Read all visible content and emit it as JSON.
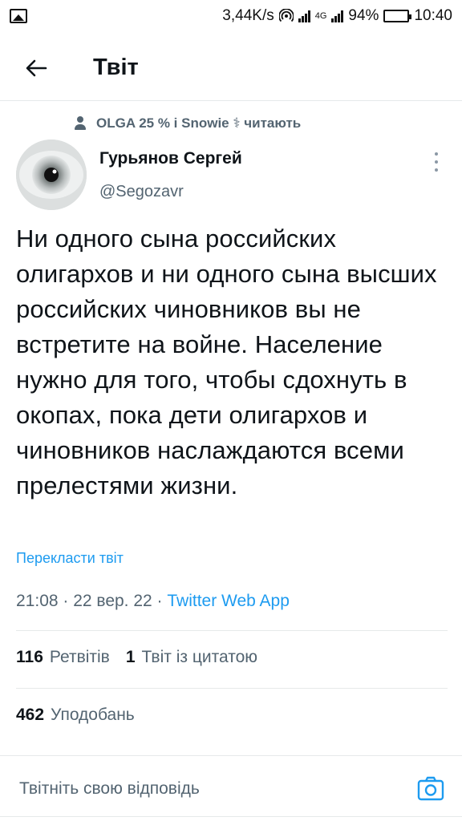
{
  "status_bar": {
    "speed": "3,44K/s",
    "network": "4G",
    "battery": "94%",
    "time": "10:40"
  },
  "header": {
    "title": "Твіт"
  },
  "social_context": "OLGA 25 % і Snowie ⚕ читають",
  "author": {
    "name": "Гурьянов Сергей",
    "handle": "@Segozavr"
  },
  "tweet": {
    "text": "Ни одного сына российских олигархов и ни одного сына высших российских чиновников вы не встретите на войне. Население нужно для того, чтобы сдохнуть в окопах, пока дети олигархов и чиновников наслаждаются всеми прелестями жизни.",
    "translate": "Перекласти твіт",
    "timestamp": "21:08 · 22 вер. 22 · ",
    "source": "Twitter Web App"
  },
  "stats": {
    "retweets_count": "116",
    "retweets_label": "Ретвітів",
    "quotes_count": "1",
    "quotes_label": "Твіт із цитатою",
    "likes_count": "462",
    "likes_label": "Уподобань"
  },
  "reply": {
    "placeholder": "Твітніть свою відповідь"
  },
  "icons": {
    "back": "arrow-left-icon",
    "more": "more-vertical-icon",
    "camera": "camera-icon",
    "person": "person-icon"
  },
  "colors": {
    "accent": "#1d9bf0",
    "text": "#0f1419",
    "secondary": "#536471"
  }
}
